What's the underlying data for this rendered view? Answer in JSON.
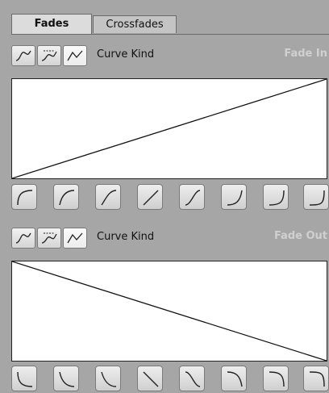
{
  "tabs": [
    {
      "label": "Fades",
      "active": true
    },
    {
      "label": "Crossfades",
      "active": false
    }
  ],
  "fade_in": {
    "title": "Fade In",
    "curve_kind_label": "Curve Kind",
    "curve_kind_icons": [
      "spline-curve-icon",
      "damped-spline-curve-icon",
      "linear-curve-icon"
    ],
    "preset_icons": [
      "preset-curve-1-icon",
      "preset-curve-2-icon",
      "preset-curve-3-icon",
      "preset-curve-4-icon",
      "preset-curve-5-icon",
      "preset-curve-6-icon",
      "preset-curve-7-icon",
      "preset-curve-8-icon"
    ]
  },
  "fade_out": {
    "title": "Fade Out",
    "curve_kind_label": "Curve Kind",
    "curve_kind_icons": [
      "spline-curve-icon",
      "damped-spline-curve-icon",
      "linear-curve-icon"
    ],
    "preset_icons": [
      "preset-curve-1-icon",
      "preset-curve-2-icon",
      "preset-curve-3-icon",
      "preset-curve-4-icon",
      "preset-curve-5-icon",
      "preset-curve-6-icon",
      "preset-curve-7-icon",
      "preset-curve-8-icon"
    ]
  },
  "colors": {
    "panel_bg": "#a6a6a6",
    "active_tab": "#dcdcdc",
    "title_text": "#d0d0d0"
  }
}
